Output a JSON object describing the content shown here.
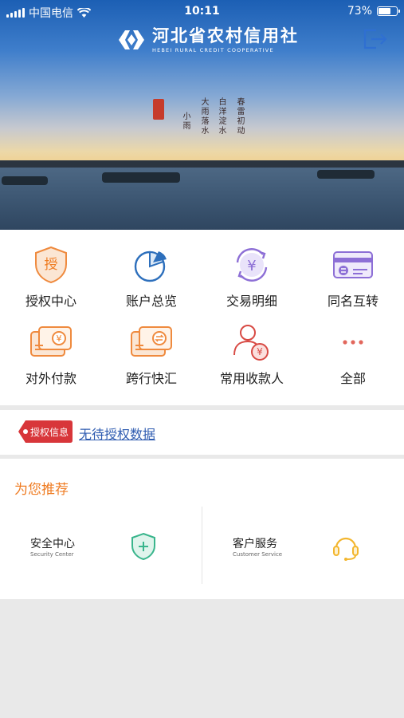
{
  "status_bar": {
    "carrier": "中国电信",
    "time": "10:11",
    "battery_percent": "73%",
    "battery_level": 0.73
  },
  "header": {
    "logo_name_cn": "河北省农村信用社",
    "logo_name_en": "HEBEI RURAL CREDIT COOPERATIVE",
    "exit_icon": "logout-icon"
  },
  "menu": [
    {
      "label": "授权中心",
      "icon": "authorize-shield-icon"
    },
    {
      "label": "账户总览",
      "icon": "pie-chart-icon"
    },
    {
      "label": "交易明细",
      "icon": "yuan-cycle-icon"
    },
    {
      "label": "同名互转",
      "icon": "card-transfer-icon"
    },
    {
      "label": "对外付款",
      "icon": "payment-card-icon"
    },
    {
      "label": "跨行快汇",
      "icon": "interbank-transfer-icon"
    },
    {
      "label": "常用收款人",
      "icon": "payee-icon"
    },
    {
      "label": "全部",
      "icon": "more-dots-icon"
    }
  ],
  "auth_info": {
    "tag": "授权信息",
    "message": "无待授权数据"
  },
  "recommend": {
    "title": "为您推荐",
    "items": [
      {
        "cn": "安全中心",
        "en": "Security Center",
        "icon": "security-shield-icon"
      },
      {
        "cn": "客户服务",
        "en": "Customer Service",
        "icon": "headset-icon"
      }
    ]
  },
  "colors": {
    "accent_orange": "#ef7b21",
    "accent_blue": "#2e5bb0",
    "tag_red": "#d8363a",
    "icon_purple": "#8d6fd6",
    "icon_red": "#d84a44",
    "icon_green": "#39b58c",
    "icon_yellow": "#f3b62e"
  }
}
